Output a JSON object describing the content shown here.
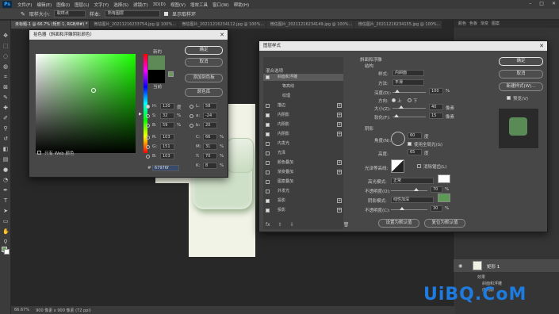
{
  "menubar": {
    "items": [
      "文件(F)",
      "编辑(E)",
      "图像(I)",
      "图层(L)",
      "文字(Y)",
      "选择(S)",
      "滤镜(T)",
      "3D(D)",
      "视图(V)",
      "增效工具",
      "窗口(W)",
      "帮助(H)"
    ]
  },
  "options": {
    "sample_size_label": "取样大小:",
    "sample_size_value": "取样点",
    "sample_label": "样本:",
    "sample_value": "所有图层",
    "show_ring_label": "显示取样环"
  },
  "tabs": [
    "未标题-1 @ 66.7% (矩形 1, RGB/8#) *",
    "微信图片_20211216233754.jpg @ 100%...",
    "微信图片_20211216234112.jpg @ 100%...",
    "微信图片_20211216234149.jpg @ 100%...",
    "微信图片_20211216234155.jpg @ 100%..."
  ],
  "status": {
    "zoom": "66.67%",
    "doc_info": "900 像素 x 900 像素 (72 ppi)"
  },
  "panels": {
    "right_tabs": [
      "颜色",
      "色板",
      "渐变",
      "图案"
    ],
    "layer_name": "矩形 1",
    "effects_label": "效果",
    "effect_items": [
      "斜面和浮雕",
      "内阴影"
    ]
  },
  "color_picker": {
    "title": "拾色器（斜面和浮雕阴影颜色）",
    "new_label": "新的",
    "current_label": "当前",
    "ok": "确定",
    "cancel": "取消",
    "add_swatch": "添加到色板",
    "color_library": "颜色库",
    "web_only": "只有 Web 颜色",
    "fields": {
      "H": "120",
      "S": "32",
      "B": "59",
      "R": "103",
      "G": "151",
      "Bv": "103",
      "L": "58",
      "a": "-24",
      "b": "20",
      "C": "66",
      "M": "31",
      "Y": "70",
      "K": "8",
      "hex": "67976f"
    },
    "units": {
      "deg": "度",
      "pct": "%"
    },
    "colors": {
      "new": "#5d8a57",
      "current": "#000000"
    }
  },
  "layer_style": {
    "title": "图层样式",
    "styles_header": "样式",
    "blend_options": "混合选项",
    "items": [
      {
        "label": "斜面和浮雕",
        "checked": true,
        "plus": false,
        "selected": true
      },
      {
        "label": "等高线",
        "checked": false,
        "plus": false,
        "indent": true
      },
      {
        "label": "纹理",
        "checked": false,
        "plus": false,
        "indent": true
      },
      {
        "label": "描边",
        "checked": false,
        "plus": true
      },
      {
        "label": "内阴影",
        "checked": true,
        "plus": true
      },
      {
        "label": "内阴影",
        "checked": true,
        "plus": true
      },
      {
        "label": "内阴影",
        "checked": true,
        "plus": true
      },
      {
        "label": "内发光",
        "checked": false,
        "plus": false
      },
      {
        "label": "光泽",
        "checked": false,
        "plus": false
      },
      {
        "label": "颜色叠加",
        "checked": false,
        "plus": true
      },
      {
        "label": "渐变叠加",
        "checked": false,
        "plus": true
      },
      {
        "label": "图案叠加",
        "checked": false,
        "plus": false
      },
      {
        "label": "外发光",
        "checked": false,
        "plus": false
      },
      {
        "label": "投影",
        "checked": true,
        "plus": true
      },
      {
        "label": "投影",
        "checked": true,
        "plus": true
      }
    ],
    "section_bevel": "斜面和浮雕",
    "section_structure": "结构",
    "style_label": "样式:",
    "style_value": "内斜面",
    "method_label": "方法:",
    "method_value": "平滑",
    "depth_label": "深度(D):",
    "depth_value": "100",
    "direction_label": "方向:",
    "dir_up": "上",
    "dir_down": "下",
    "size_label": "大小(Z):",
    "size_value": "40",
    "soften_label": "软化(F):",
    "soften_value": "15",
    "px": "像素",
    "pct": "%",
    "deg": "度",
    "section_shading": "阴影",
    "angle_label": "角度(N):",
    "angle_value": "60",
    "global_light": "使用全局光(G)",
    "altitude_label": "高度:",
    "altitude_value": "65",
    "gloss_label": "光泽等高线:",
    "anti_alias": "消除锯齿(L)",
    "hl_mode_label": "高光模式:",
    "hl_mode_value": "正常",
    "hl_opacity_label": "不透明度(O):",
    "hl_opacity_value": "70",
    "sh_mode_label": "阴影模式:",
    "sh_mode_value": "线性加深",
    "sh_opacity_label": "不透明度(C):",
    "sh_opacity_value": "30",
    "set_default": "设置为默认值",
    "reset_default": "复位为默认值",
    "ok": "确定",
    "cancel": "取消",
    "new_style": "新建样式(W)...",
    "preview": "预览(V)",
    "colors": {
      "highlight": "#ffffff",
      "shadow": "#5d9a56"
    }
  },
  "watermark": "UiBQ.CoM"
}
